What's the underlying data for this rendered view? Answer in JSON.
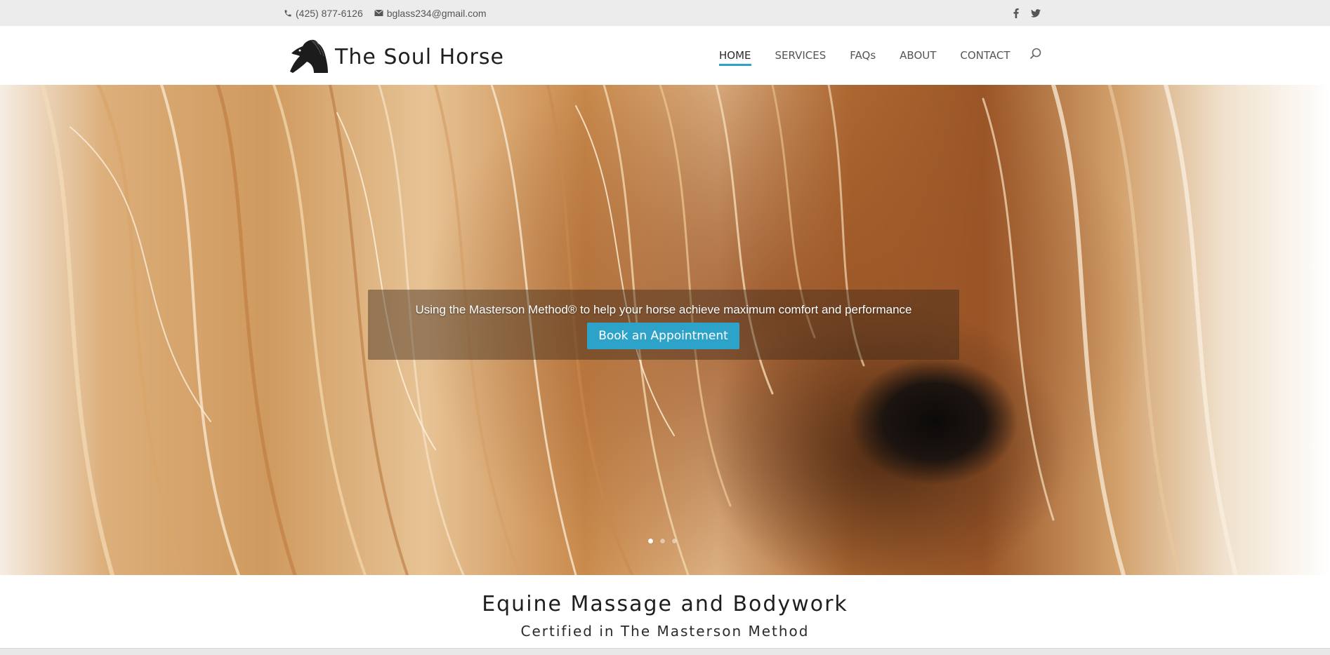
{
  "topbar": {
    "phone": "(425) 877-6126",
    "email": "bglass234@gmail.com",
    "social": [
      "facebook-icon",
      "twitter-icon"
    ]
  },
  "header": {
    "site_title": "The Soul Horse",
    "nav": [
      {
        "label": "HOME",
        "active": true
      },
      {
        "label": "SERVICES",
        "active": false
      },
      {
        "label": "FAQs",
        "active": false
      },
      {
        "label": "ABOUT",
        "active": false
      },
      {
        "label": "CONTACT",
        "active": false
      }
    ],
    "search_icon": "search-icon"
  },
  "hero": {
    "tagline": "Using the Masterson Method® to help your horse achieve maximum comfort and performance",
    "button_label": "Book an Appointment",
    "slides": 3,
    "active_slide": 1
  },
  "intro": {
    "title": "Equine Massage and Bodywork",
    "subtitle": "Certified in The Masterson Method"
  },
  "colors": {
    "accent": "#2ea3c9",
    "topbar_bg": "#ececec"
  }
}
